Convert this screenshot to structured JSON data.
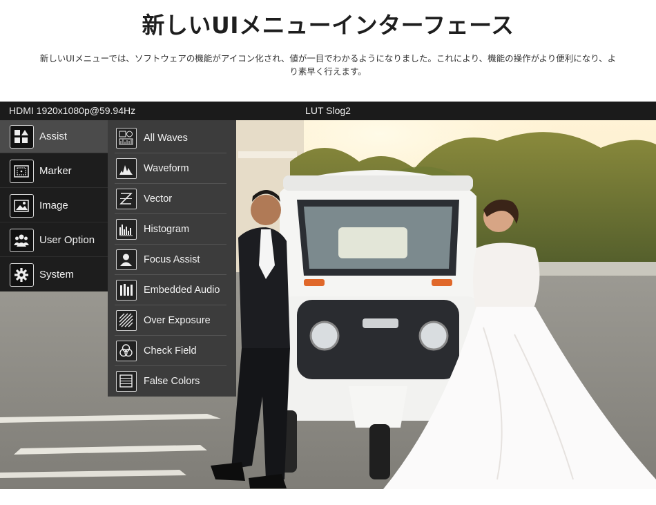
{
  "page": {
    "title": "新しいUIメニューインターフェース",
    "description_line1": "新しいUIメニューでは、ソフトウェアの機能がアイコン化され、値が一目でわかるようになりました。これにより、機能の操作がより便利になり、よ",
    "description_line2": "り素早く行えます。"
  },
  "status_bar": {
    "signal": "HDMI 1920x1080p@59.94Hz",
    "lut": "LUT Slog2"
  },
  "main_menu": {
    "items": [
      {
        "label": "Assist",
        "icon": "assist-icon",
        "selected": true
      },
      {
        "label": "Marker",
        "icon": "marker-icon"
      },
      {
        "label": "Image",
        "icon": "image-icon"
      },
      {
        "label": "User Option",
        "icon": "user-option-icon"
      },
      {
        "label": "System",
        "icon": "gear-icon"
      }
    ]
  },
  "assist_submenu": {
    "items": [
      {
        "label": "All Waves",
        "icon": "all-waves-icon"
      },
      {
        "label": "Waveform",
        "icon": "waveform-icon"
      },
      {
        "label": "Vector",
        "icon": "vector-icon"
      },
      {
        "label": "Histogram",
        "icon": "histogram-icon"
      },
      {
        "label": "Focus Assist",
        "icon": "focus-assist-icon"
      },
      {
        "label": "Embedded Audio",
        "icon": "embedded-audio-icon"
      },
      {
        "label": "Over Exposure",
        "icon": "over-exposure-icon"
      },
      {
        "label": "Check Field",
        "icon": "check-field-icon"
      },
      {
        "label": "False Colors",
        "icon": "false-colors-icon"
      }
    ]
  },
  "colors": {
    "status_bar_bg": "#1b1b1b",
    "main_menu_bg": "#1d1d1d",
    "selected_bg": "#4b4b4b",
    "submenu_bg": "#3c3c3c"
  }
}
